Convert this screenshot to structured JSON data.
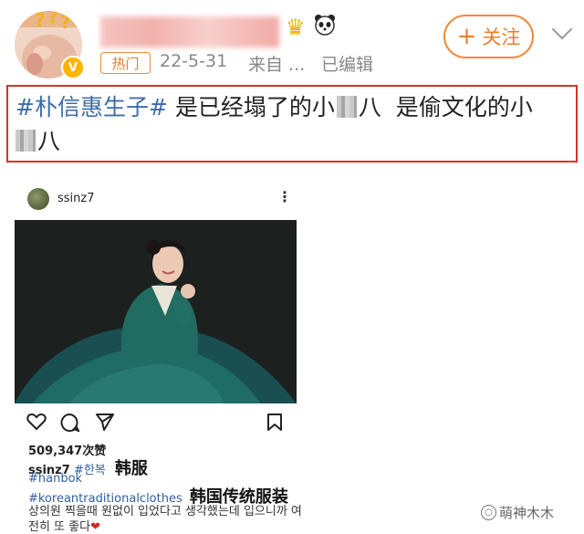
{
  "header": {
    "hot_tag": "热门",
    "date": "22-5-31",
    "source": "来自 ...",
    "edited": "已编辑",
    "follow_label": "关注",
    "follow_icon": "plus-icon",
    "badge": "V"
  },
  "post": {
    "hashtag": "#朴信惠生子#",
    "text_part1": "是已经塌了的小",
    "text_part2": "八  是偷文化的小",
    "text_part3": "八",
    "highlight_color": "#d9312b"
  },
  "instagram": {
    "username": "ssinz7",
    "likes": "509,347次赞",
    "caption_user": "ssinz7",
    "caption_tag1": "#한복",
    "caption_tag1_cn": "韩服",
    "caption_tag2": "#hanbok",
    "caption_tag3": "#koreantraditionalclothes",
    "caption_tag3_cn": "韩国传统服装",
    "korean_line1": "상의원 찍을때 원없이 입었다고 생각했는데 입으니까 여",
    "korean_line2": "전히 또 좋다",
    "heart": "❤"
  },
  "watermark": {
    "text": "萌神木木"
  },
  "colors": {
    "accent_orange": "#ef7d2b",
    "hashtag_blue": "#3e6ea8",
    "hanbok_green": "#1f6b5e"
  }
}
